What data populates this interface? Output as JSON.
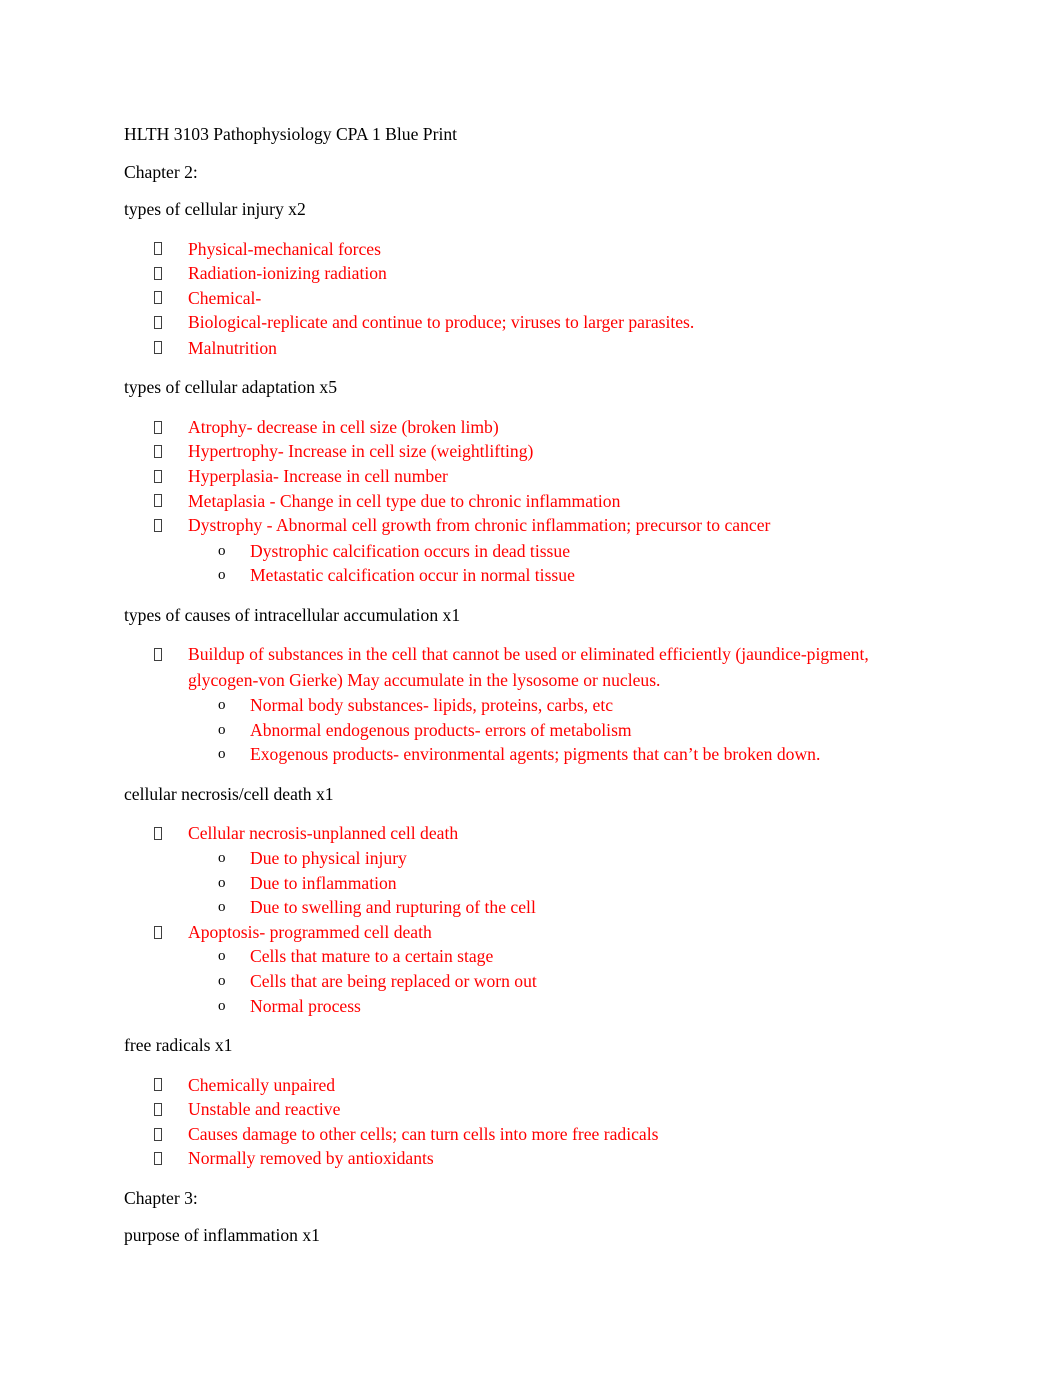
{
  "document": {
    "title": "HLTH 3103 Pathophysiology CPA 1 Blue Print",
    "text_color": "#000000",
    "accent_color": "#ff0000",
    "bullet_marker_glyph": "tofu-box",
    "sub_bullet_marker_glyph": "o",
    "sections": [
      {
        "heading": "Chapter 2:",
        "topics": [
          {
            "prompt": "types of cellular injury x2",
            "items": [
              {
                "text": "Physical-mechanical forces",
                "subitems": []
              },
              {
                "text": "Radiation-ionizing radiation",
                "subitems": []
              },
              {
                "text": "Chemical-",
                "subitems": []
              },
              {
                "text": "Biological-replicate and continue to produce; viruses to larger parasites.",
                "subitems": []
              },
              {
                "text": "Malnutrition",
                "subitems": []
              }
            ]
          },
          {
            "prompt": "types of cellular adaptation x5",
            "items": [
              {
                "text": "Atrophy- decrease in cell size (broken limb)",
                "subitems": []
              },
              {
                "text": "Hypertrophy- Increase in cell size (weightlifting)",
                "subitems": []
              },
              {
                "text": "Hyperplasia- Increase in cell number",
                "subitems": []
              },
              {
                "text": "Metaplasia - Change in cell type due to chronic inflammation",
                "subitems": []
              },
              {
                "text": "Dystrophy - Abnormal cell growth from chronic inflammation; precursor to cancer",
                "subitems": [
                  "Dystrophic calcification occurs in dead tissue",
                  "Metastatic calcification occur in normal tissue"
                ]
              }
            ]
          },
          {
            "prompt": "types of causes of intracellular accumulation x1",
            "items": [
              {
                "text": "Buildup of substances in the cell that cannot be used or eliminated efficiently (jaundice-pigment, glycogen-von Gierke) May accumulate in the lysosome or nucleus.",
                "subitems": [
                  "Normal body substances- lipids, proteins, carbs, etc",
                  "Abnormal endogenous products- errors of metabolism",
                  "Exogenous products- environmental agents; pigments that can’t be broken down."
                ]
              }
            ]
          },
          {
            "prompt": "cellular necrosis/cell death x1",
            "items": [
              {
                "text": "Cellular necrosis-unplanned cell death",
                "subitems": [
                  "Due to physical injury",
                  "Due to inflammation",
                  "Due to swelling and rupturing of the cell"
                ]
              },
              {
                "text": "Apoptosis- programmed cell death",
                "subitems": [
                  "Cells that mature to a certain stage",
                  "Cells that are being replaced or worn out",
                  "Normal process"
                ]
              }
            ]
          },
          {
            "prompt": "free radicals x1",
            "items": [
              {
                "text": "Chemically unpaired",
                "subitems": []
              },
              {
                "text": "Unstable and reactive",
                "subitems": []
              },
              {
                "text": "Causes damage to other cells; can turn cells into more free radicals",
                "subitems": []
              },
              {
                "text": "Normally removed by antioxidants",
                "subitems": []
              }
            ]
          }
        ]
      },
      {
        "heading": "Chapter 3:",
        "topics": [
          {
            "prompt": "purpose of inflammation x1",
            "items": []
          }
        ]
      }
    ]
  }
}
